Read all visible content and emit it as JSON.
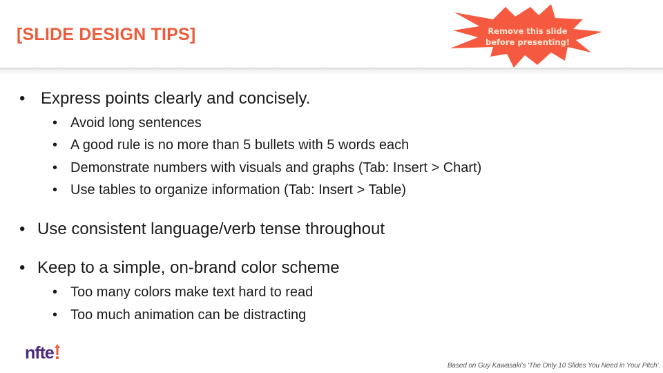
{
  "header": {
    "title": "[SLIDE DESIGN TIPS]",
    "title_color": "#ec5b3c",
    "starburst": {
      "line1": "Remove this slide",
      "line2": "before presenting!",
      "fill_color": "#f55a40",
      "text_color": "#fbe7d2"
    }
  },
  "content": {
    "sections": [
      {
        "bullet": "•",
        "text": "Express points clearly and concisely.",
        "subitems": [
          {
            "bullet": "•",
            "text": "Avoid long sentences"
          },
          {
            "bullet": "•",
            "text": "A good rule is no more than 5 bullets with 5 words each"
          },
          {
            "bullet": "•",
            "text": "Demonstrate numbers with visuals and graphs (Tab: Insert > Chart)"
          },
          {
            "bullet": "•",
            "text": "Use tables to organize information (Tab: Insert > Table)"
          }
        ]
      },
      {
        "bullet": "•",
        "text": "Use consistent language/verb tense throughout",
        "subitems": []
      },
      {
        "bullet": "•",
        "text": "Keep to a simple, on-brand color scheme",
        "subitems": [
          {
            "bullet": "•",
            "text": "Too many colors make text hard to read"
          },
          {
            "bullet": "•",
            "text": "Too much animation can be distracting"
          }
        ]
      }
    ]
  },
  "footer": {
    "logo_text": "nfte",
    "logo_color": "#4b2a7d",
    "logo_accent_color": "#ec5b3c",
    "note": "Based on Guy Kawasaki's 'The Only 10 Slides You Need in Your Pitch'."
  }
}
